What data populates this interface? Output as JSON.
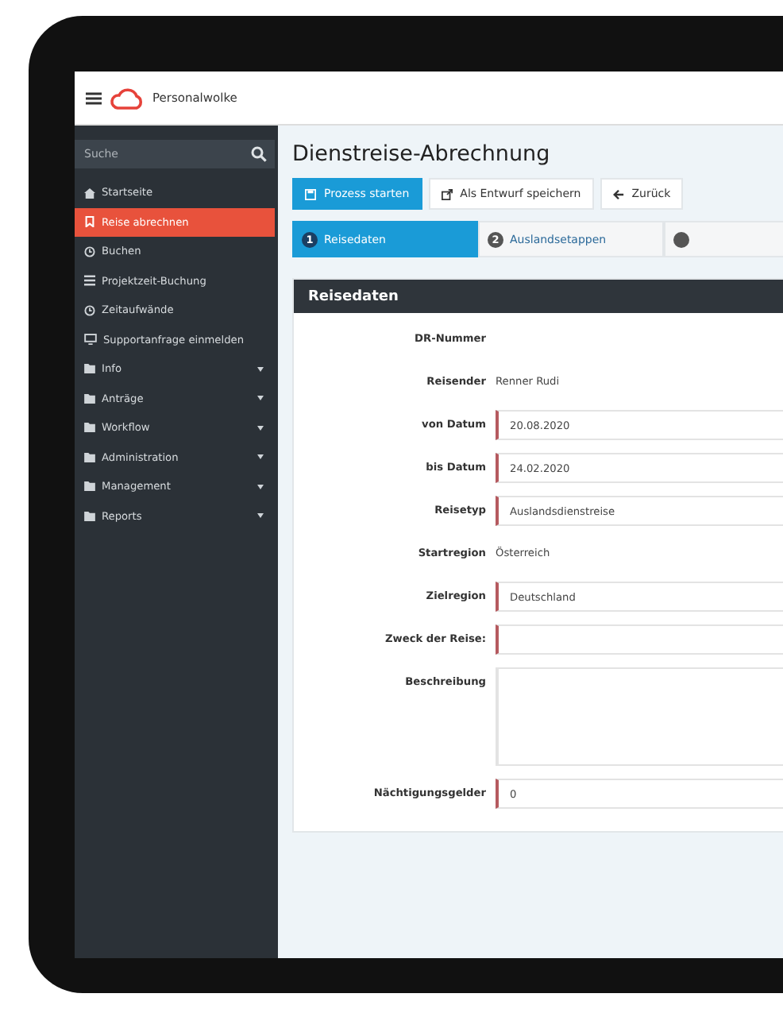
{
  "header": {
    "app_name": "Personalwolke"
  },
  "sidebar": {
    "search": {
      "placeholder": "Suche"
    },
    "items": [
      {
        "label": "Startseite",
        "kind": "home",
        "selected": false,
        "expandable": false
      },
      {
        "label": "Reise abrechnen",
        "kind": "travel",
        "selected": true,
        "expandable": false
      },
      {
        "label": "Buchen",
        "kind": "clock",
        "selected": false,
        "expandable": false
      },
      {
        "label": "Projektzeit-Buchung",
        "kind": "list",
        "selected": false,
        "expandable": false
      },
      {
        "label": "Zeitaufwände",
        "kind": "clock",
        "selected": false,
        "expandable": false
      },
      {
        "label": "Supportanfrage einmelden",
        "kind": "monitor",
        "selected": false,
        "expandable": false
      },
      {
        "label": "Info",
        "kind": "folder",
        "selected": false,
        "expandable": true
      },
      {
        "label": "Anträge",
        "kind": "folder",
        "selected": false,
        "expandable": true
      },
      {
        "label": "Workflow",
        "kind": "folder",
        "selected": false,
        "expandable": true
      },
      {
        "label": "Administration",
        "kind": "folder",
        "selected": false,
        "expandable": true
      },
      {
        "label": "Management",
        "kind": "folder",
        "selected": false,
        "expandable": true
      },
      {
        "label": "Reports",
        "kind": "folder",
        "selected": false,
        "expandable": true
      }
    ]
  },
  "page": {
    "title": "Dienstreise-Abrechnung",
    "buttons": [
      {
        "label": "Prozess starten",
        "kind": "primary"
      },
      {
        "label": "Als Entwurf speichern",
        "kind": "default"
      },
      {
        "label": "Zurück",
        "kind": "default"
      }
    ],
    "steps": [
      {
        "number": "1",
        "label": "Reisedaten",
        "selected": true
      },
      {
        "number": "2",
        "label": "Auslandsetappen",
        "selected": false
      },
      {
        "selected": false
      }
    ]
  },
  "panel": {
    "title": "Reisedaten",
    "rows": [
      {
        "label": "DR-Nummer",
        "kind": "static"
      },
      {
        "label": "Reisender",
        "kind": "static",
        "value": "Renner Rudi"
      },
      {
        "label": "von Datum",
        "kind": "input",
        "value": "20.08.2020",
        "required": true
      },
      {
        "label": "bis Datum",
        "kind": "input",
        "value": "24.02.2020",
        "required": true
      },
      {
        "label": "Reisetyp",
        "kind": "input",
        "value": "Auslandsdienstreise",
        "required": true
      },
      {
        "label": "Startregion",
        "kind": "static",
        "value": "Österreich"
      },
      {
        "label": "Zielregion",
        "kind": "input",
        "value": "Deutschland",
        "required": true
      },
      {
        "label": "Zweck der Reise:",
        "kind": "input",
        "required": true
      },
      {
        "label": "Beschreibung",
        "kind": "textarea",
        "required": false
      },
      {
        "label": "Nächtigungsgelder",
        "kind": "input",
        "value": "0",
        "required": true
      }
    ]
  }
}
